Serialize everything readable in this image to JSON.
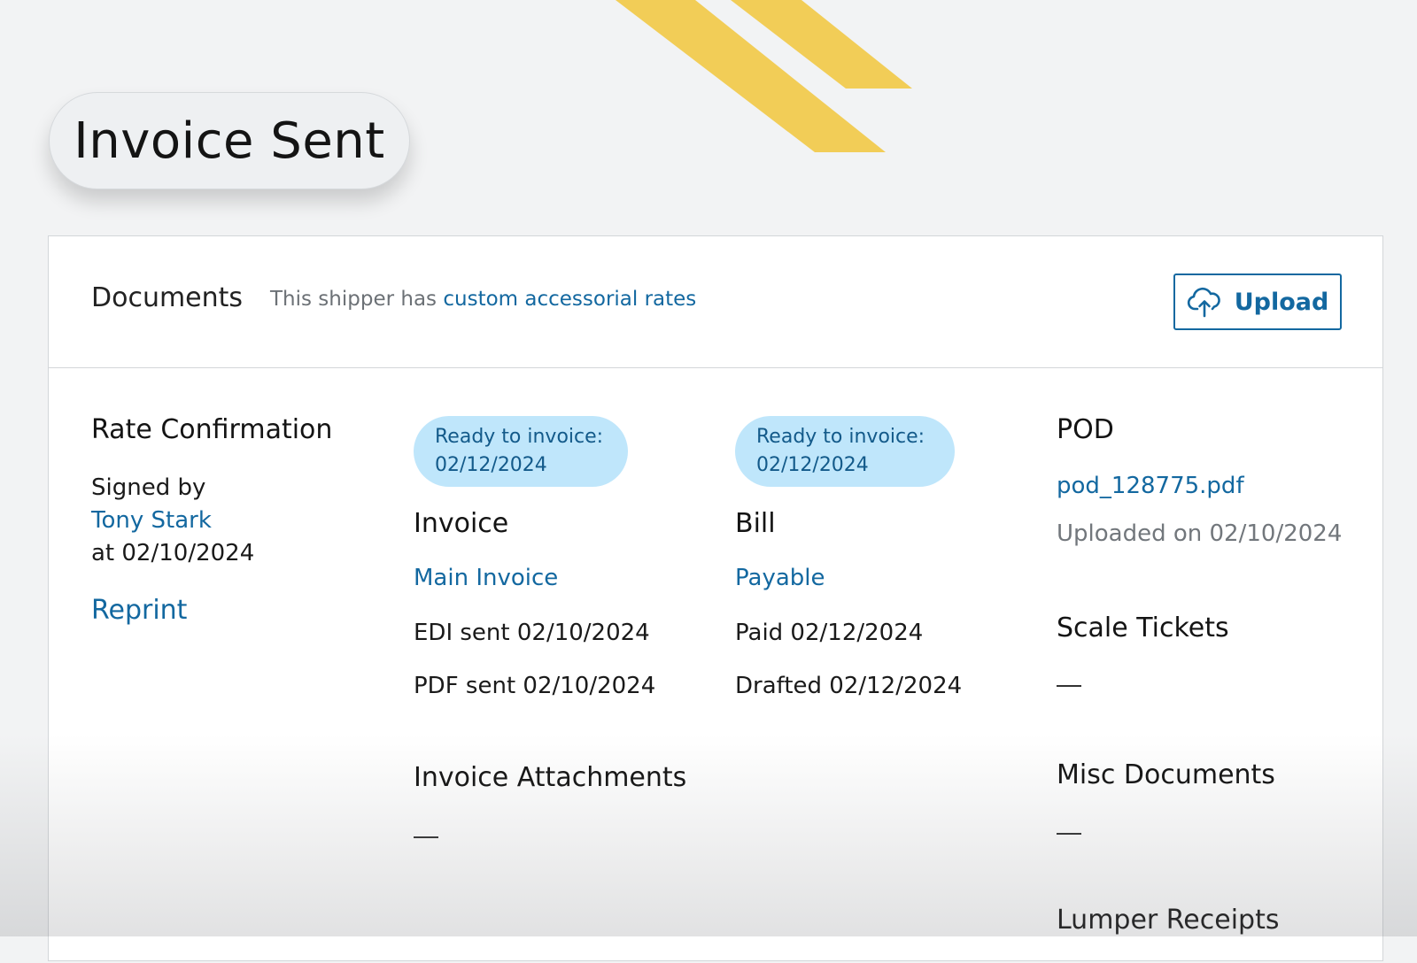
{
  "status": {
    "label": "Invoice Sent"
  },
  "colors": {
    "accent": "#1368a0",
    "badge_bg": "#bfe6fb",
    "stripe": "#f2cd57"
  },
  "documents": {
    "title": "Documents",
    "note_prefix": "This shipper has",
    "note_link": "custom accessorial rates",
    "upload_label": "Upload",
    "upload_icon": "cloud-upload-icon"
  },
  "rate_confirmation": {
    "title": "Rate Confirmation",
    "signed_by_label": "Signed by",
    "signer": "Tony Stark",
    "signed_at": "at 02/10/2024",
    "reprint_label": "Reprint"
  },
  "invoice": {
    "badge_line1": "Ready to invoice:",
    "badge_line2": "02/12/2024",
    "title": "Invoice",
    "link": "Main Invoice",
    "edi_sent": "EDI sent 02/10/2024",
    "pdf_sent": "PDF sent 02/10/2024",
    "attachments_title": "Invoice Attachments",
    "attachments_empty": "—"
  },
  "bill": {
    "badge_line1": "Ready to invoice:",
    "badge_line2": "02/12/2024",
    "title": "Bill",
    "link": "Payable",
    "paid": "Paid 02/12/2024",
    "drafted": "Drafted 02/12/2024"
  },
  "pod": {
    "title": "POD",
    "file": "pod_128775.pdf",
    "uploaded": "Uploaded on 02/10/2024",
    "scale_tickets_title": "Scale Tickets",
    "scale_tickets_empty": "—",
    "misc_title": "Misc Documents",
    "misc_empty": "—",
    "lumper_title": "Lumper Receipts"
  }
}
